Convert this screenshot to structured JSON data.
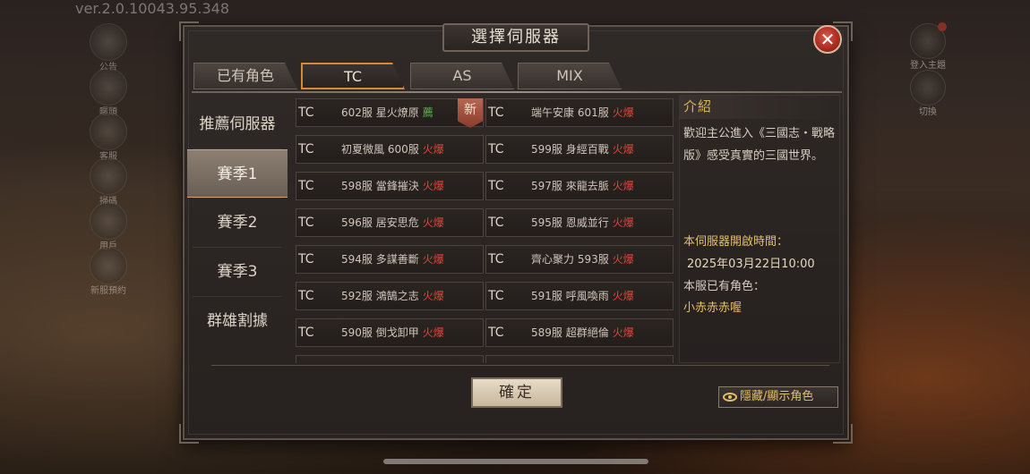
{
  "version": "ver.2.0.10043.95.348",
  "side_icons": [
    {
      "name": "announce-icon",
      "label": "公告"
    },
    {
      "name": "profile-icon",
      "label": "暱頭"
    },
    {
      "name": "service-icon",
      "label": "客服"
    },
    {
      "name": "scan-icon",
      "label": "掃碼"
    },
    {
      "name": "user-icon",
      "label": "用戶"
    },
    {
      "name": "new-server-icon",
      "label": "新服預約"
    }
  ],
  "right_icons": [
    {
      "name": "theme-icon",
      "label": "登入主題"
    },
    {
      "name": "view-2d3d-icon",
      "label": "切換"
    }
  ],
  "dialog": {
    "title": "選擇伺服器",
    "close": "✕",
    "tabs": [
      {
        "label": "已有角色",
        "active": false
      },
      {
        "label": "TC",
        "active": true
      },
      {
        "label": "AS",
        "active": false
      },
      {
        "label": "MIX",
        "active": false
      }
    ],
    "categories": [
      {
        "label": "推薦伺服器",
        "active": false
      },
      {
        "label": "賽季1",
        "active": true
      },
      {
        "label": "賽季2",
        "active": false
      },
      {
        "label": "賽季3",
        "active": false
      },
      {
        "label": "群雄割據",
        "active": false
      }
    ],
    "servers": [
      {
        "region": "TC",
        "name": "602服 星火燎原",
        "tag": "薦",
        "tag_type": "rec",
        "badge": "新"
      },
      {
        "region": "TC",
        "name": "端午安康 601服",
        "tag": "火爆",
        "tag_type": "hot"
      },
      {
        "region": "TC",
        "name": "初夏微風 600服",
        "tag": "火爆",
        "tag_type": "hot"
      },
      {
        "region": "TC",
        "name": "599服 身經百戰",
        "tag": "火爆",
        "tag_type": "hot"
      },
      {
        "region": "TC",
        "name": "598服 當鋒摧決",
        "tag": "火爆",
        "tag_type": "hot"
      },
      {
        "region": "TC",
        "name": "597服 來龍去脈",
        "tag": "火爆",
        "tag_type": "hot"
      },
      {
        "region": "TC",
        "name": "596服 居安思危",
        "tag": "火爆",
        "tag_type": "hot"
      },
      {
        "region": "TC",
        "name": "595服 恩威並行",
        "tag": "火爆",
        "tag_type": "hot"
      },
      {
        "region": "TC",
        "name": "594服 多謀善斷",
        "tag": "火爆",
        "tag_type": "hot"
      },
      {
        "region": "TC",
        "name": "齊心聚力 593服",
        "tag": "火爆",
        "tag_type": "hot"
      },
      {
        "region": "TC",
        "name": "592服 鴻鵠之志",
        "tag": "火爆",
        "tag_type": "hot"
      },
      {
        "region": "TC",
        "name": "591服 呼風喚雨",
        "tag": "火爆",
        "tag_type": "hot"
      },
      {
        "region": "TC",
        "name": "590服 倒戈卸甲",
        "tag": "火爆",
        "tag_type": "hot"
      },
      {
        "region": "TC",
        "name": "589服 超群絕倫",
        "tag": "火爆",
        "tag_type": "hot"
      },
      {
        "region": "",
        "name": "",
        "tag": "",
        "tag_type": ""
      },
      {
        "region": "",
        "name": "",
        "tag": "",
        "tag_type": ""
      }
    ],
    "intro": {
      "heading": "介紹",
      "body": "歡迎主公進入《三國志・戰略版》感受真實的三國世界。",
      "open_label": "本伺服器開啟時間：",
      "open_time": "2025年03月22日10:00",
      "own_label": "本服已有角色：",
      "own_name": "小赤赤赤喔"
    },
    "confirm": "確定",
    "toggle": "隱藏/顯示角色"
  },
  "colors": {
    "accent": "#d58a3a",
    "hot": "#e0443a",
    "rec": "#5bb04f",
    "gold": "#e3bf6a"
  }
}
